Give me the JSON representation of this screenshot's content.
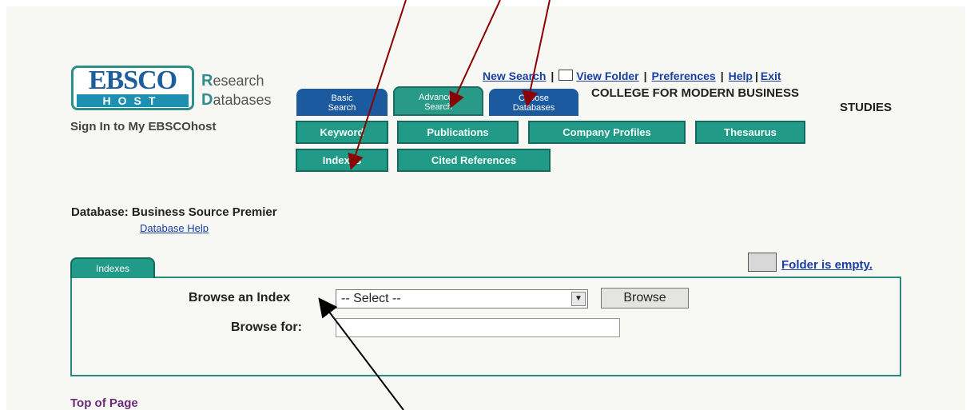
{
  "logo": {
    "ebsco": "EBSCO",
    "host": "HOST",
    "research_initial": "R",
    "research_rest": "esearch",
    "databases_initial": "D",
    "databases_rest": "atabases"
  },
  "sign_in": "Sign In to My EBSCOhost",
  "top_links": {
    "new_search": "New Search",
    "view_folder": "View Folder",
    "preferences": "Preferences",
    "help": "Help",
    "exit": "Exit",
    "separator": "|"
  },
  "institution": {
    "line1": "COLLEGE FOR MODERN BUSINESS",
    "line2": "STUDIES"
  },
  "tabs": {
    "basic": {
      "line1": "Basic",
      "line2": "Search"
    },
    "advanced": {
      "line1": "Advanced",
      "line2": "Search"
    },
    "choose": {
      "line1": "Choose",
      "line2": "Databases"
    }
  },
  "sub_buttons": {
    "keyword": "Keyword",
    "publications": "Publications",
    "company_profiles": "Company Profiles",
    "thesaurus": "Thesaurus",
    "indexes": "Indexes",
    "cited_references": "Cited References"
  },
  "database": {
    "label": "Database: Business Source Premier",
    "help": "Database Help"
  },
  "indexes_panel": {
    "tab": "Indexes",
    "folder_status": "Folder is empty.",
    "browse_index_label": "Browse an Index",
    "select_value": "-- Select --",
    "browse_button": "Browse",
    "browse_for_label": "Browse for:",
    "browse_for_value": ""
  },
  "top_of_page": "Top of Page",
  "colors": {
    "teal": "#219b88",
    "blue_tab": "#1c5aa0",
    "link": "#1a3fa0",
    "arrow_red": "#8b0000",
    "arrow_black": "#000000"
  }
}
